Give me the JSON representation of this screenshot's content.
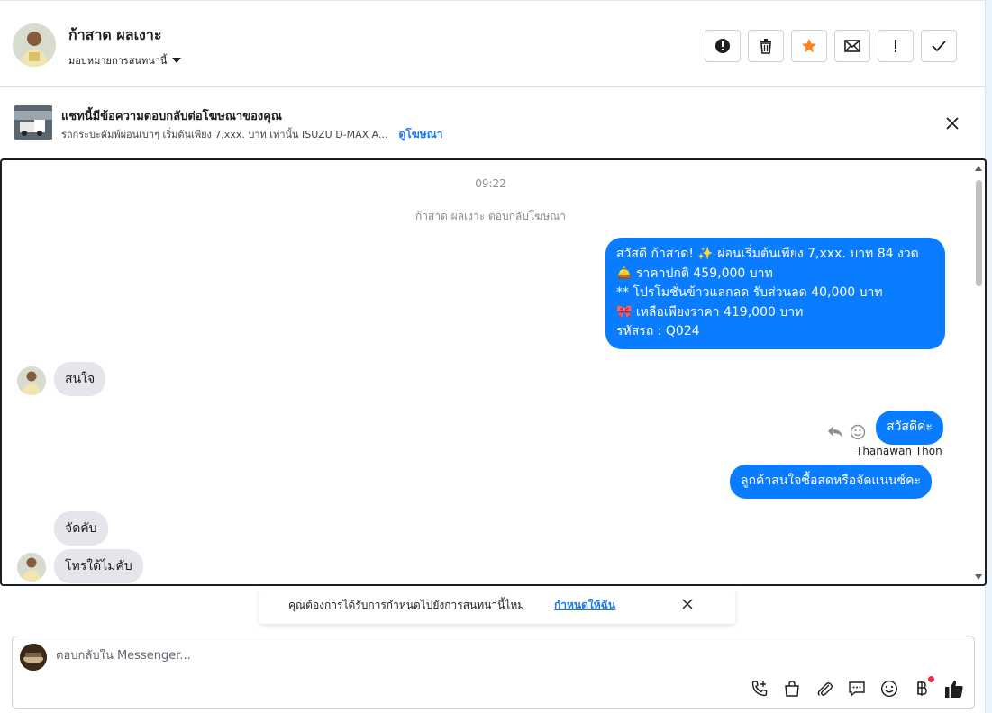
{
  "header": {
    "name": "ก้าสาด ผลเงาะ",
    "assign_label": "มอบหมายการสนทนานี้"
  },
  "ad_banner": {
    "title": "แชทนี้มีข้อความตอบกลับต่อโฆษณาของคุณ",
    "subtitle": "รถกระบะดัมพ์ผ่อนเบาๆ เริ่มต้นเพียง 7,xxx. บาท เท่านั้น ISUZU D-MAX A...",
    "link": "ดูโฆษณา"
  },
  "chat": {
    "timestamp": "09:22",
    "system_note": "ก้าสาด ผลเงาะ ตอบกลับโฆษณา",
    "outgoing_ad_message": [
      "สวัสดี ก้าสาด! ✨  ผ่อนเริ่มต้นเพียง 7,xxx. บาท 84 งวด",
      "🛎️ ราคาปกติ 459,000 บาท",
      "** โปรโมชั่นข้าวแลกลด รับส่วนลด 40,000 บาท",
      "🎀  เหลือเพียงราคา 419,000 บาท",
      " รหัสรถ : Q024"
    ],
    "incoming_1": "สนใจ",
    "outgoing_2": "สวัสดีค่ะ",
    "outgoing_sender": "Thanawan Thon",
    "outgoing_3": "ลูกค้าสนใจซื้อสดหรือจัดแนนซ์คะ",
    "incoming_2": "จัดคับ",
    "incoming_3": "โทรใด้ไมคับ"
  },
  "toast": {
    "text": "คุณต้องการได้รับการกำหนดไปยังการสนทนานี้ไหม",
    "link": "กำหนดให้ฉัน"
  },
  "composer": {
    "placeholder": "ตอบกลับใน Messenger..."
  },
  "colors": {
    "bubble_out": "#0a7cff",
    "bubble_in": "#e4e6eb",
    "link": "#1877f2",
    "star": "#f5861f"
  },
  "icons": {
    "header_actions": [
      "alert-circle-icon",
      "trash-icon",
      "star-icon",
      "envelope-icon",
      "exclamation-icon",
      "check-icon"
    ],
    "composer_tools": [
      "phone-plus-icon",
      "shopping-bag-icon",
      "paperclip-icon",
      "chat-bubble-icon",
      "emoji-icon",
      "baht-icon",
      "thumbs-up-icon"
    ]
  }
}
